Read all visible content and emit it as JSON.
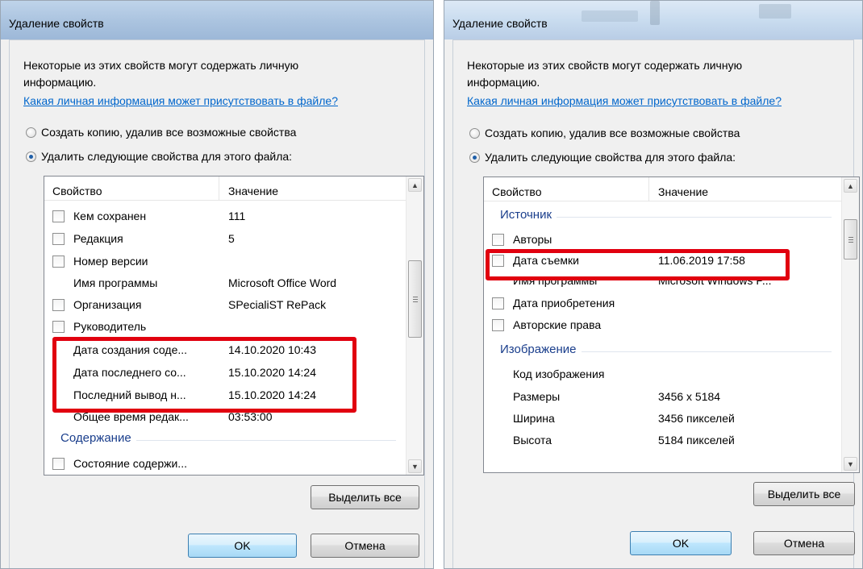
{
  "left_dialog": {
    "title": "Удаление свойств",
    "info_line1": "Некоторые из этих свойств могут содержать личную",
    "info_line2": "информацию.",
    "link": "Какая личная информация может присутствовать в файле?",
    "option_copy": "Создать копию, удалив все возможные свойства",
    "option_remove": "Удалить следующие свойства для этого файла:",
    "selected_option": "option_remove",
    "columns": [
      "Свойство",
      "Значение"
    ],
    "rows": [
      {
        "name": "Кем сохранен",
        "value": "111",
        "checkbox": true
      },
      {
        "name": "Редакция",
        "value": "5",
        "checkbox": true
      },
      {
        "name": "Номер версии",
        "value": "",
        "checkbox": true
      },
      {
        "name": "Имя программы",
        "value": "Microsoft Office Word",
        "checkbox": false
      },
      {
        "name": "Организация",
        "value": "SPecialiST RePack",
        "checkbox": true
      },
      {
        "name": "Руководитель",
        "value": "",
        "checkbox": true
      },
      {
        "name": "Дата создания соде...",
        "value": "14.10.2020 10:43",
        "checkbox": false
      },
      {
        "name": "Дата последнего со...",
        "value": "15.10.2020 14:24",
        "checkbox": false
      },
      {
        "name": "Последний вывод н...",
        "value": "15.10.2020 14:24",
        "checkbox": false
      },
      {
        "name": "Общее время редак...",
        "value": "03:53:00",
        "checkbox": false
      }
    ],
    "group": "Содержание",
    "partial_row": "Состояние содержи...",
    "select_all": "Выделить все",
    "ok": "OK",
    "cancel": "Отмена"
  },
  "right_dialog": {
    "title": "Удаление свойств",
    "info_line1": "Некоторые из этих свойств могут содержать личную",
    "info_line2": "информацию.",
    "link": "Какая личная информация может присутствовать в файле?",
    "option_copy": "Создать копию, удалив все возможные свойства",
    "option_remove": "Удалить следующие свойства для этого файла:",
    "selected_option": "option_remove",
    "columns": [
      "Свойство",
      "Значение"
    ],
    "group_source": "Источник",
    "source_rows": [
      {
        "name": "Авторы",
        "value": "",
        "checkbox": true
      },
      {
        "name": "Дата съемки",
        "value": "11.06.2019 17:58",
        "checkbox": true
      },
      {
        "name": "Имя программы",
        "value": "Microsoft Windows P...",
        "checkbox": false
      },
      {
        "name": "Дата приобретения",
        "value": "",
        "checkbox": true
      },
      {
        "name": "Авторские права",
        "value": "",
        "checkbox": true
      }
    ],
    "group_image": "Изображение",
    "image_rows": [
      {
        "name": "Код изображения",
        "value": "",
        "checkbox": false
      },
      {
        "name": "Размеры",
        "value": "3456 x 5184",
        "checkbox": false
      },
      {
        "name": "Ширина",
        "value": "3456 пикселей",
        "checkbox": false
      },
      {
        "name": "Высота",
        "value": "5184 пикселей",
        "checkbox": false
      }
    ],
    "select_all": "Выделить все",
    "ok": "OK",
    "cancel": "Отмена"
  },
  "colors": {
    "highlight": "#e1000f",
    "link": "#0066cc",
    "group_text": "#1a3e8c"
  }
}
